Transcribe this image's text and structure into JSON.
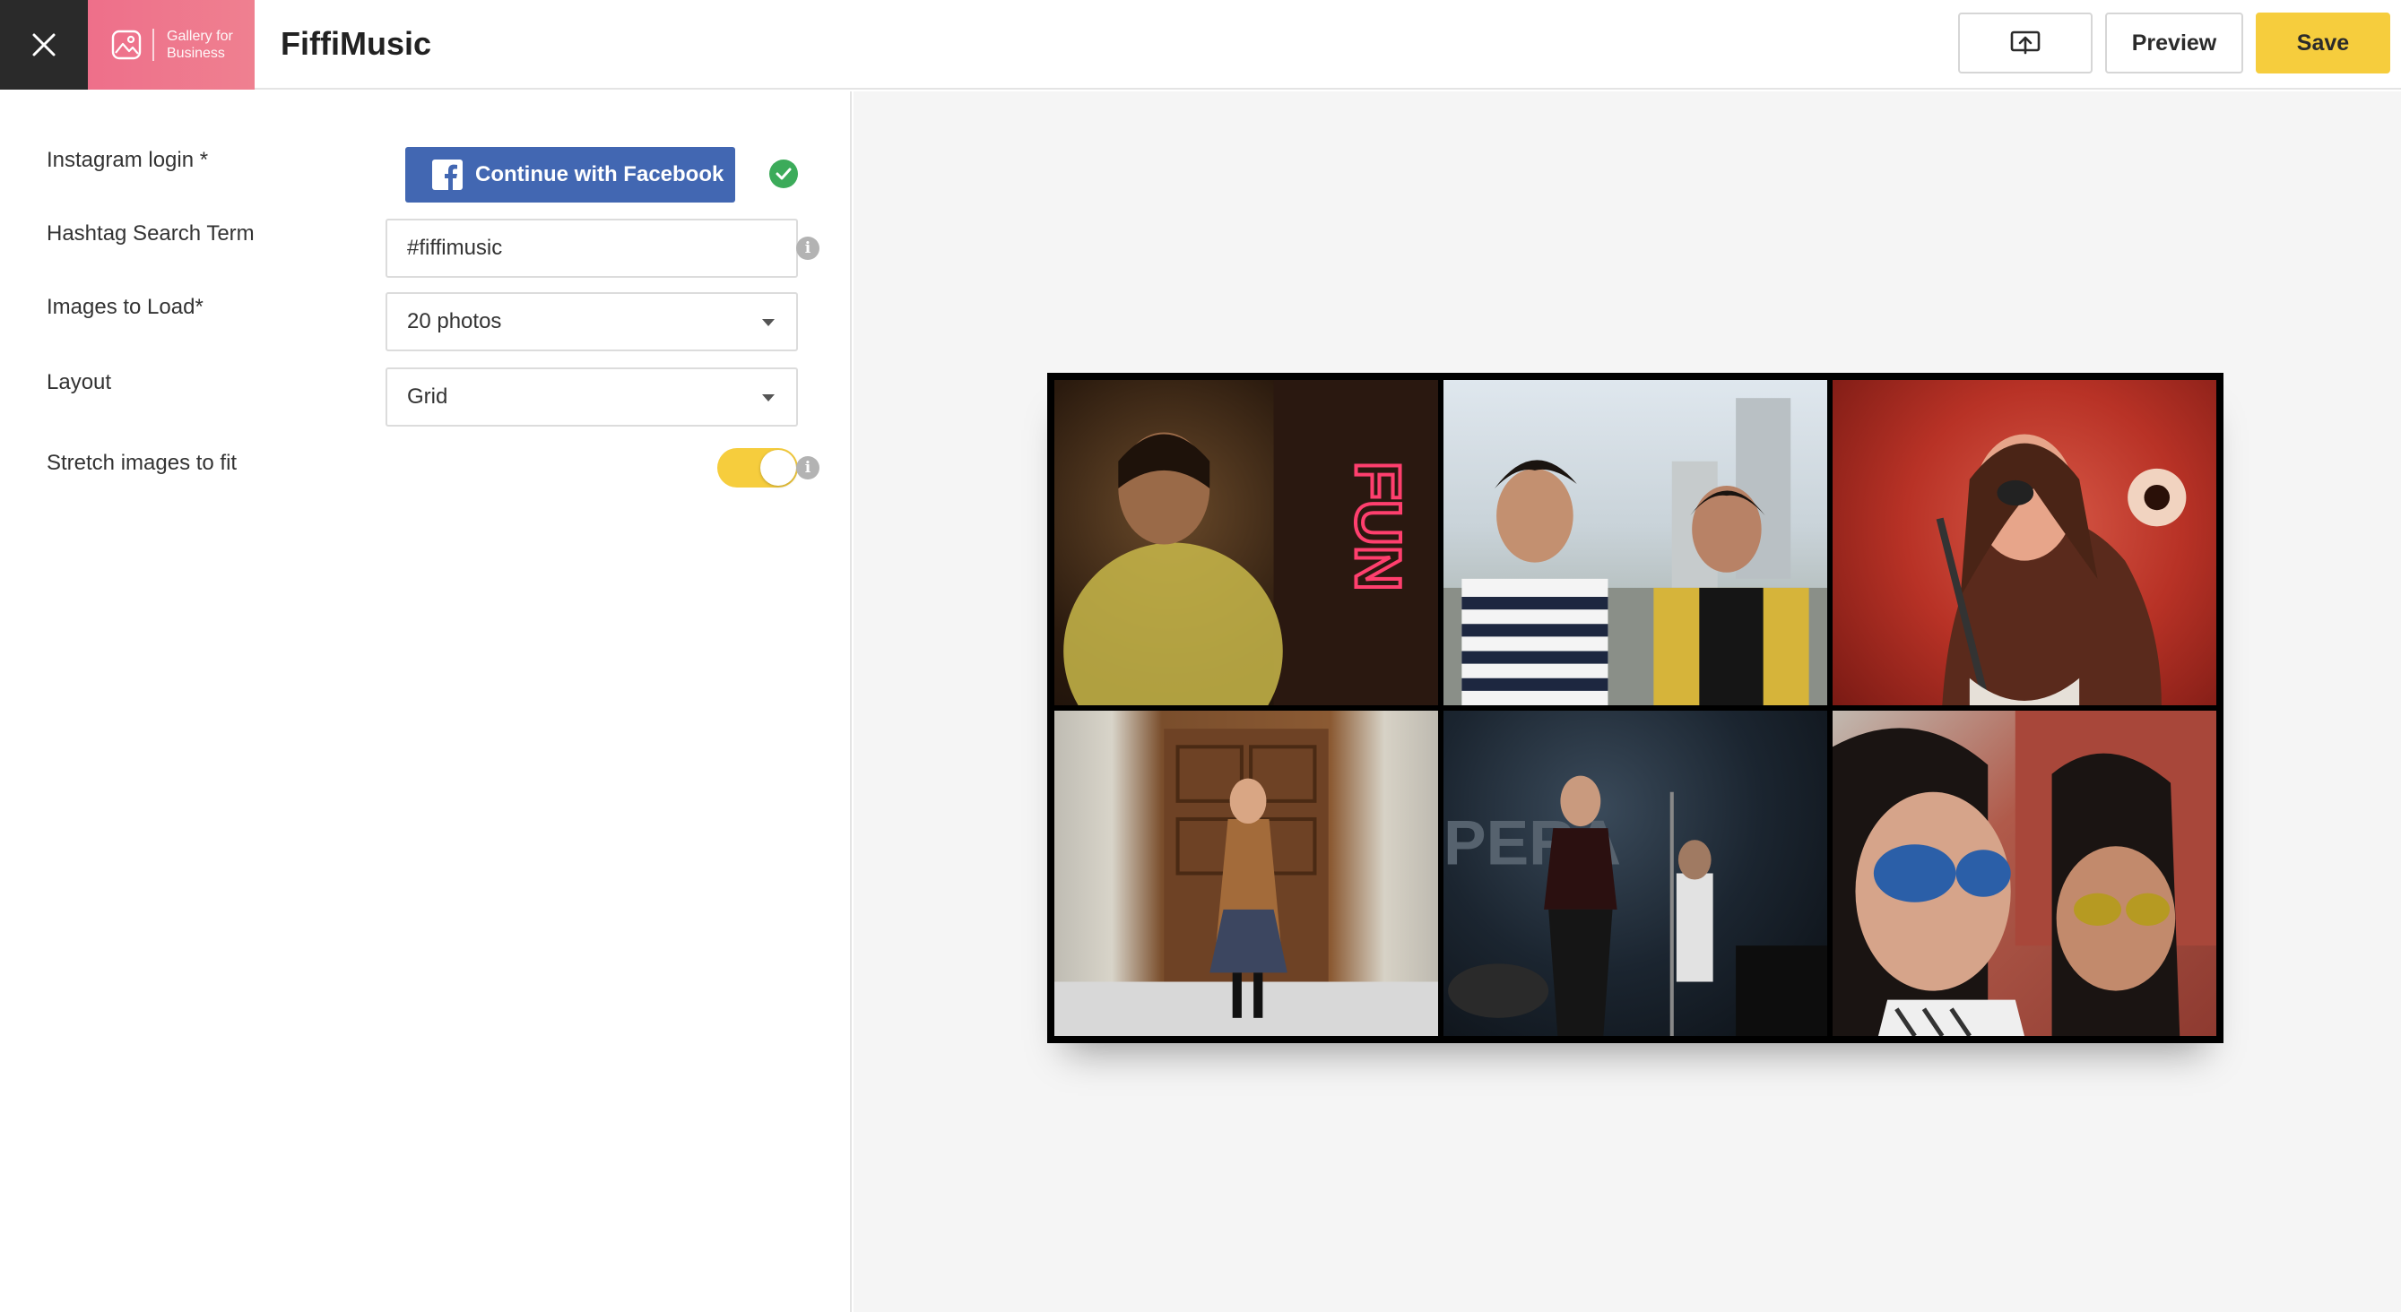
{
  "header": {
    "brand_text_line1": "Gallery for",
    "brand_text_line2": "Business",
    "title": "FiffiMusic",
    "preview_label": "Preview",
    "save_label": "Save"
  },
  "form": {
    "instagram_label": "Instagram login *",
    "facebook_button_label": "Continue with Facebook",
    "hashtag_label": "Hashtag Search Term",
    "hashtag_value": "#fiffimusic",
    "images_label": "Images to Load*",
    "images_value": "20 photos",
    "layout_label": "Layout",
    "layout_value": "Grid",
    "stretch_label": "Stretch images to fit",
    "stretch_enabled": true,
    "info_glyph": "i"
  },
  "colors": {
    "accent": "#f6cd3d",
    "facebook": "#4267b2",
    "success": "#3cab5a",
    "brand_pink": "#ee6f8a"
  },
  "gallery": {
    "layout": "grid",
    "rows": 2,
    "columns": 3,
    "tiles": [
      "photo-1",
      "photo-2",
      "photo-3",
      "photo-4",
      "photo-5",
      "photo-6"
    ]
  }
}
